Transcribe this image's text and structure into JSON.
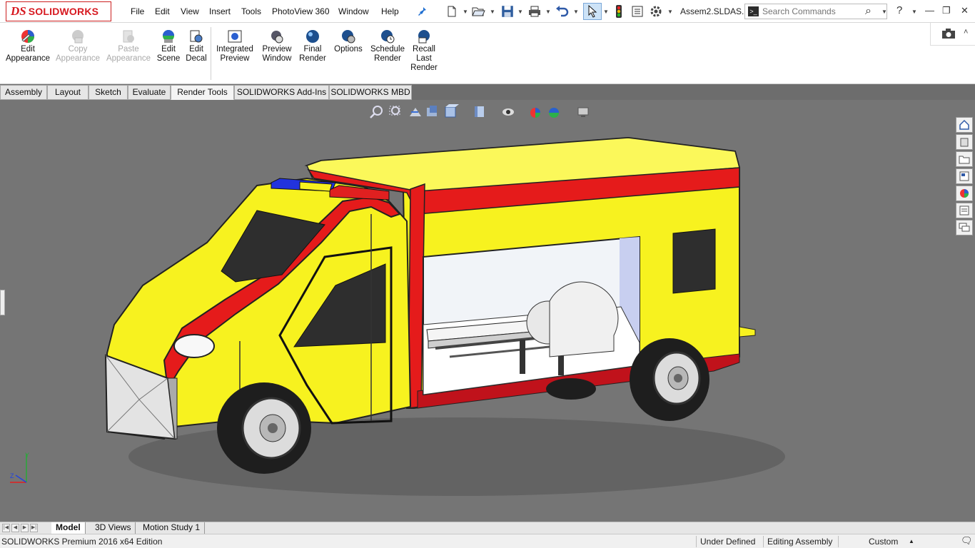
{
  "app": {
    "brand_ds": "DS",
    "brand_name": "SOLIDWORKS",
    "document_title": "Assem2.SLDAS..."
  },
  "menu": [
    "File",
    "Edit",
    "View",
    "Insert",
    "Tools",
    "PhotoView 360",
    "Window",
    "Help"
  ],
  "search": {
    "placeholder": "Search Commands"
  },
  "commands": [
    {
      "line1": "Edit",
      "line2": "Appearance",
      "line3": "",
      "icon": "edit-appearance-icon",
      "enabled": true
    },
    {
      "line1": "Copy",
      "line2": "Appearance",
      "line3": "",
      "icon": "copy-appearance-icon",
      "enabled": false
    },
    {
      "line1": "Paste",
      "line2": "Appearance",
      "line3": "",
      "icon": "paste-appearance-icon",
      "enabled": false
    },
    {
      "line1": "Edit",
      "line2": "Scene",
      "line3": "",
      "icon": "edit-scene-icon",
      "enabled": true
    },
    {
      "line1": "Edit",
      "line2": "Decal",
      "line3": "",
      "icon": "edit-decal-icon",
      "enabled": true
    },
    {
      "line1": "Integrated",
      "line2": "Preview",
      "line3": "",
      "icon": "integrated-preview-icon",
      "enabled": true
    },
    {
      "line1": "Preview",
      "line2": "Window",
      "line3": "",
      "icon": "preview-window-icon",
      "enabled": true
    },
    {
      "line1": "Final",
      "line2": "Render",
      "line3": "",
      "icon": "final-render-icon",
      "enabled": true
    },
    {
      "line1": "Options",
      "line2": "",
      "line3": "",
      "icon": "options-icon",
      "enabled": true
    },
    {
      "line1": "Schedule",
      "line2": "Render",
      "line3": "",
      "icon": "schedule-render-icon",
      "enabled": true
    },
    {
      "line1": "Recall",
      "line2": "Last",
      "line3": "Render",
      "icon": "recall-last-render-icon",
      "enabled": true
    }
  ],
  "tabs": [
    {
      "label": "Assembly",
      "active": false
    },
    {
      "label": "Layout",
      "active": false
    },
    {
      "label": "Sketch",
      "active": false
    },
    {
      "label": "Evaluate",
      "active": false
    },
    {
      "label": "Render Tools",
      "active": true
    },
    {
      "label": "SOLIDWORKS Add-Ins",
      "active": false
    },
    {
      "label": "SOLIDWORKS MBD",
      "active": false
    }
  ],
  "bottom_tabs": [
    {
      "label": "Model",
      "active": true
    },
    {
      "label": "3D Views",
      "active": false
    },
    {
      "label": "Motion Study 1",
      "active": false
    }
  ],
  "status": {
    "edition": "SOLIDWORKS Premium 2016 x64 Edition",
    "definition": "Under Defined",
    "mode": "Editing Assembly",
    "units": "Custom"
  },
  "colors": {
    "brand_red": "#d71920",
    "viewport_bg": "#757575",
    "ambulance_yellow": "#f7f21f",
    "ambulance_red": "#e51b1b",
    "light_blue": "#2233dd"
  }
}
